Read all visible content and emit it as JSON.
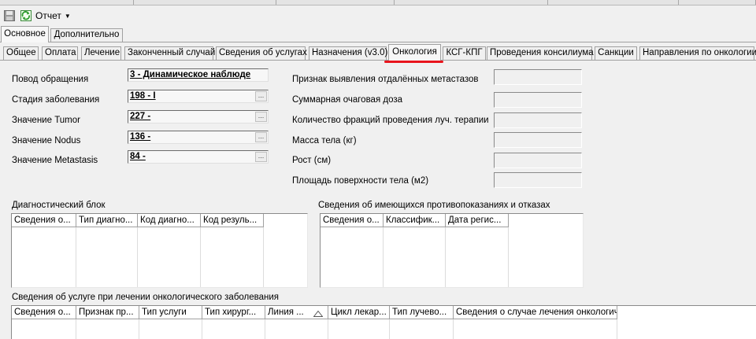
{
  "toolbar": {
    "report_label": "Отчет"
  },
  "main_tabs": [
    "Основное",
    "Дополнительно"
  ],
  "sub_tabs": [
    "Общее",
    "Оплата",
    "Лечение",
    "Законченный случай",
    "Сведения об услугах",
    "Назначения (v3.0)",
    "Онкология",
    "КСГ-КПГ",
    "Проведения консилиума",
    "Санкции",
    "Направления по онкологии"
  ],
  "left_fields": [
    {
      "label": "Повод обращения",
      "value": "3 - Динамическое наблюде"
    },
    {
      "label": "Стадия заболевания",
      "value": "198 - I"
    },
    {
      "label": "Значение Tumor",
      "value": "227 -"
    },
    {
      "label": "Значение Nodus",
      "value": "136 -"
    },
    {
      "label": "Значение Metastasis",
      "value": "84 -"
    }
  ],
  "right_fields": [
    {
      "label": "Признак выявления отдалённых метастазов",
      "value": ""
    },
    {
      "label": "Суммарная очаговая доза",
      "value": ""
    },
    {
      "label": "Количество фракций проведения луч. терапии",
      "value": ""
    },
    {
      "label": "Масса тела (кг)",
      "value": ""
    },
    {
      "label": "Рост (см)",
      "value": ""
    },
    {
      "label": "Площадь поверхности тела (м2)",
      "value": ""
    }
  ],
  "diag_block": {
    "title": "Диагностический блок",
    "columns": [
      "Сведения о...",
      "Тип диагно...",
      "Код диагно...",
      "Код резуль..."
    ]
  },
  "contra_block": {
    "title": "Сведения об имеющихся противопоказаниях и отказах",
    "columns": [
      "Сведения о...",
      "Классифик...",
      "Дата регис..."
    ]
  },
  "service_block": {
    "title": "Сведения об услуге при лечении онкологического заболевания",
    "columns": [
      "Сведения о...",
      "Признак пр...",
      "Тип услуги",
      "Тип хирург...",
      "Линия ...",
      "Цикл лекар...",
      "Тип лучево...",
      "Сведения о случае лечения онкологич..."
    ]
  },
  "colors": {
    "highlight": "#e8141c",
    "panel": "#f0f0f0"
  }
}
